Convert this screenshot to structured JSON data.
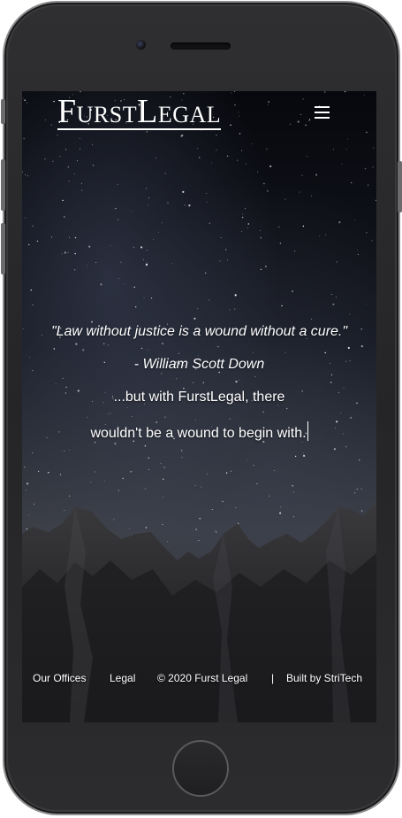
{
  "header": {
    "logo_first_initial": "F",
    "logo_first_rest": "URST",
    "logo_second_initial": "L",
    "logo_second_rest": "EGAL",
    "menu_icon": "hamburger-menu-icon"
  },
  "hero": {
    "quote": "\"Law without justice is a wound without a cure.\"",
    "attribution": "- William Scott Down",
    "tagline_line1": "...but with FurstLegal, there",
    "tagline_line2": "wouldn't be a wound to begin with."
  },
  "footer": {
    "offices": "Our Offices",
    "legal": "Legal",
    "copyright": "©  2020 Furst Legal",
    "separator": "|",
    "built_by": "Built by StriTech"
  },
  "colors": {
    "text": "#ffffff",
    "phone_body": "#2b2b2d",
    "screen_background": "#0c0e14"
  }
}
